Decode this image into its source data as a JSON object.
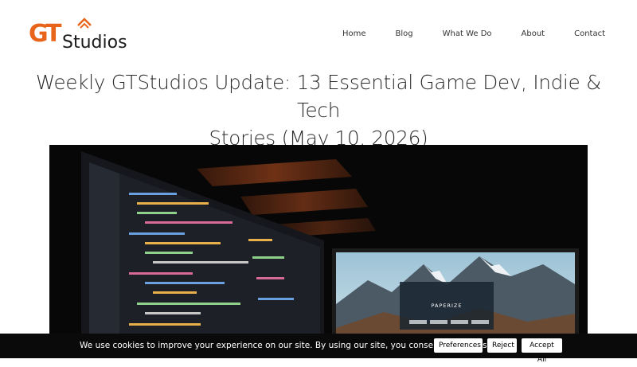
{
  "brand": {
    "logo_letters": "GT",
    "logo_word": "Studios",
    "color_primary": "#e8641b",
    "color_dark": "#1c1c1c"
  },
  "nav": {
    "items": [
      {
        "label": "Home"
      },
      {
        "label": "Blog"
      },
      {
        "label": "What We Do"
      },
      {
        "label": "About"
      },
      {
        "label": "Contact"
      }
    ]
  },
  "article": {
    "title_line1": "Weekly GTStudios Update: 13 Essential Game Dev, Indie & Tech",
    "title_line2": "Stories (May 10, 2026)"
  },
  "hero": {
    "screen_label": "PAPERIZE"
  },
  "cookie": {
    "message": "We use cookies to improve your experience on our site. By using our site, you consent to cookies.",
    "preferences_label": "Preferences",
    "reject_label": "Reject",
    "accept_label": "Accept All"
  }
}
